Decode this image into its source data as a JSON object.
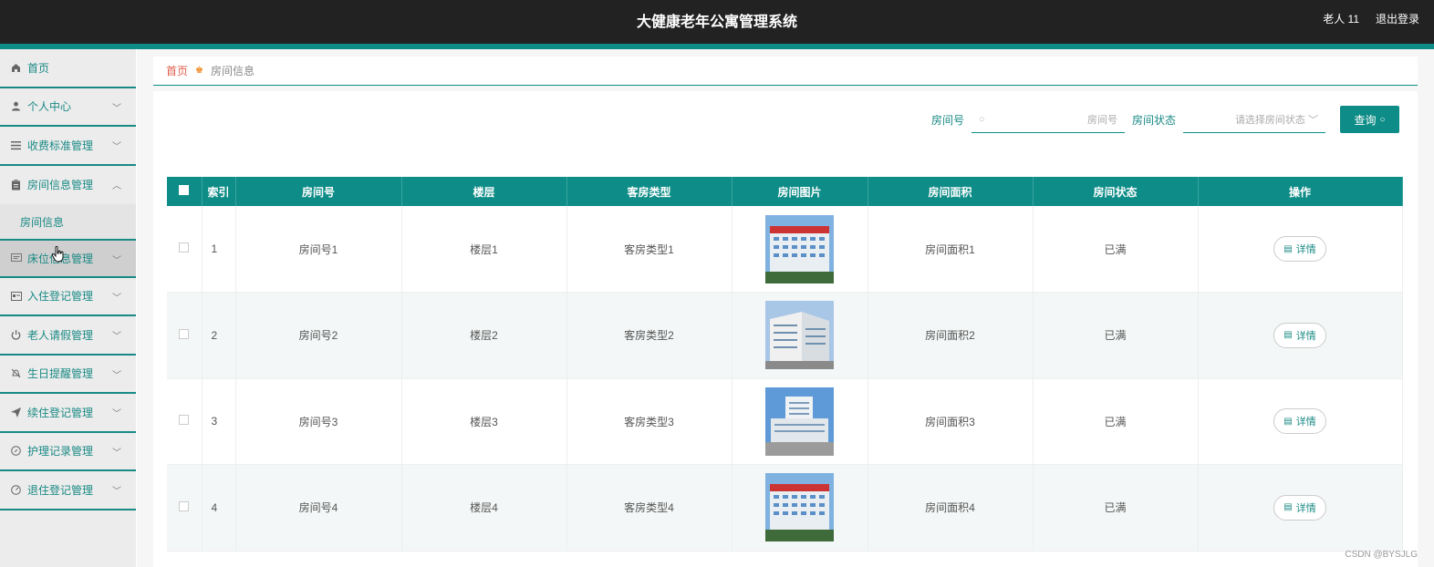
{
  "header": {
    "title": "大健康老年公寓管理系统",
    "user": "老人 11",
    "logout": "退出登录"
  },
  "sidebar": {
    "items": [
      {
        "label": "首页",
        "icon": "home-icon",
        "chevron": false
      },
      {
        "label": "个人中心",
        "icon": "user-icon",
        "chevron": true
      },
      {
        "label": "收费标准管理",
        "icon": "list-icon",
        "chevron": true
      },
      {
        "label": "房间信息管理",
        "icon": "clipboard-icon",
        "chevron": true,
        "expanded": true
      },
      {
        "label": "床位信息管理",
        "icon": "message-icon",
        "chevron": true,
        "hover": true
      },
      {
        "label": "入住登记管理",
        "icon": "card-icon",
        "chevron": true
      },
      {
        "label": "老人请假管理",
        "icon": "power-icon",
        "chevron": true
      },
      {
        "label": "生日提醒管理",
        "icon": "bell-off-icon",
        "chevron": true
      },
      {
        "label": "续住登记管理",
        "icon": "send-icon",
        "chevron": true
      },
      {
        "label": "护理记录管理",
        "icon": "compass-icon",
        "chevron": true
      },
      {
        "label": "退住登记管理",
        "icon": "gauge-icon",
        "chevron": true
      }
    ],
    "submenu": "房间信息"
  },
  "breadcrumb": {
    "home": "首页",
    "current": "房间信息"
  },
  "search": {
    "room_label": "房间号",
    "room_placeholder": "房间号",
    "status_label": "房间状态",
    "status_placeholder": "请选择房间状态",
    "query_button": "查询"
  },
  "table": {
    "headers": [
      "索引",
      "房间号",
      "楼层",
      "客房类型",
      "房间图片",
      "房间面积",
      "房间状态",
      "操作"
    ],
    "rows": [
      {
        "index": "1",
        "room": "房间号1",
        "floor": "楼层1",
        "type": "客房类型1",
        "area": "房间面积1",
        "status": "已满",
        "action": "详情"
      },
      {
        "index": "2",
        "room": "房间号2",
        "floor": "楼层2",
        "type": "客房类型2",
        "area": "房间面积2",
        "status": "已满",
        "action": "详情"
      },
      {
        "index": "3",
        "room": "房间号3",
        "floor": "楼层3",
        "type": "客房类型3",
        "area": "房间面积3",
        "status": "已满",
        "action": "详情"
      },
      {
        "index": "4",
        "room": "房间号4",
        "floor": "楼层4",
        "type": "客房类型4",
        "area": "房间面积4",
        "status": "已满",
        "action": "详情"
      }
    ]
  },
  "watermark": "CSDN @BYSJLG",
  "colors": {
    "accent": "#0e8c87",
    "topbar": "#222222",
    "breadcrumb_home": "#e05a47"
  }
}
